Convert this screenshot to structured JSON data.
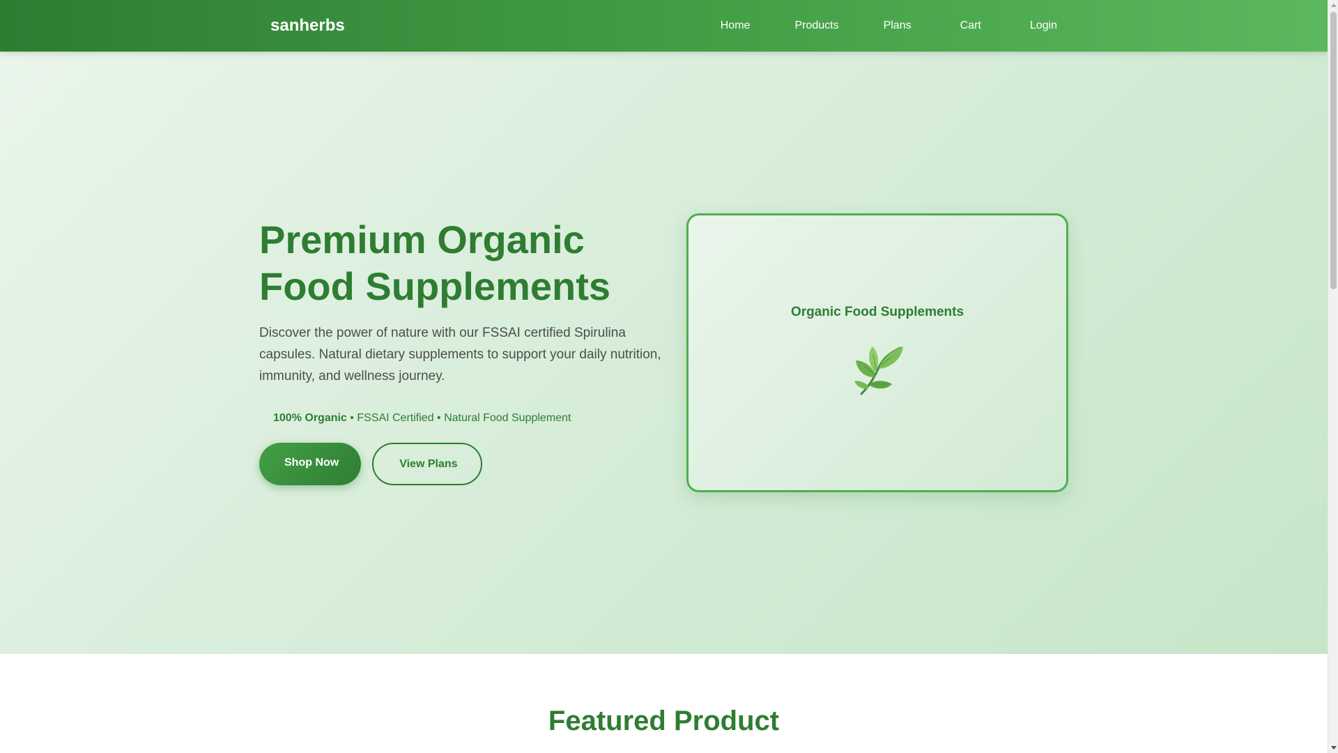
{
  "nav": {
    "brand": "sanherbs",
    "brand_icon": "",
    "links": [
      {
        "label": "Home",
        "icon": ""
      },
      {
        "label": "Products",
        "icon": ""
      },
      {
        "label": "Plans",
        "icon": ""
      },
      {
        "label": "Cart",
        "icon": ""
      },
      {
        "label": "Login",
        "icon": ""
      }
    ]
  },
  "hero": {
    "title_line1": "Premium Organic",
    "title_line2": "Food Supplements",
    "description": "Discover the power of nature with our FSSAI certified Spirulina capsules. Natural dietary supplements to support your daily nutrition, immunity, and wellness journey.",
    "badge_icon": "",
    "badge_strong": "100% Organic",
    "badge_rest": " • FSSAI Certified • Natural Food Supplement",
    "primary_button": {
      "icon": "",
      "label": "Shop Now"
    },
    "secondary_button": {
      "icon": "",
      "label": "View Plans"
    },
    "card": {
      "title": "Organic Food Supplements",
      "icon": "leaf-icon"
    }
  },
  "featured": {
    "title": "Featured Product"
  },
  "colors": {
    "brand_green": "#2e7d32",
    "accent_green": "#4caf50",
    "nav_gradient_end": "#5cb85f",
    "hero_bg": "#d6ecd8"
  }
}
